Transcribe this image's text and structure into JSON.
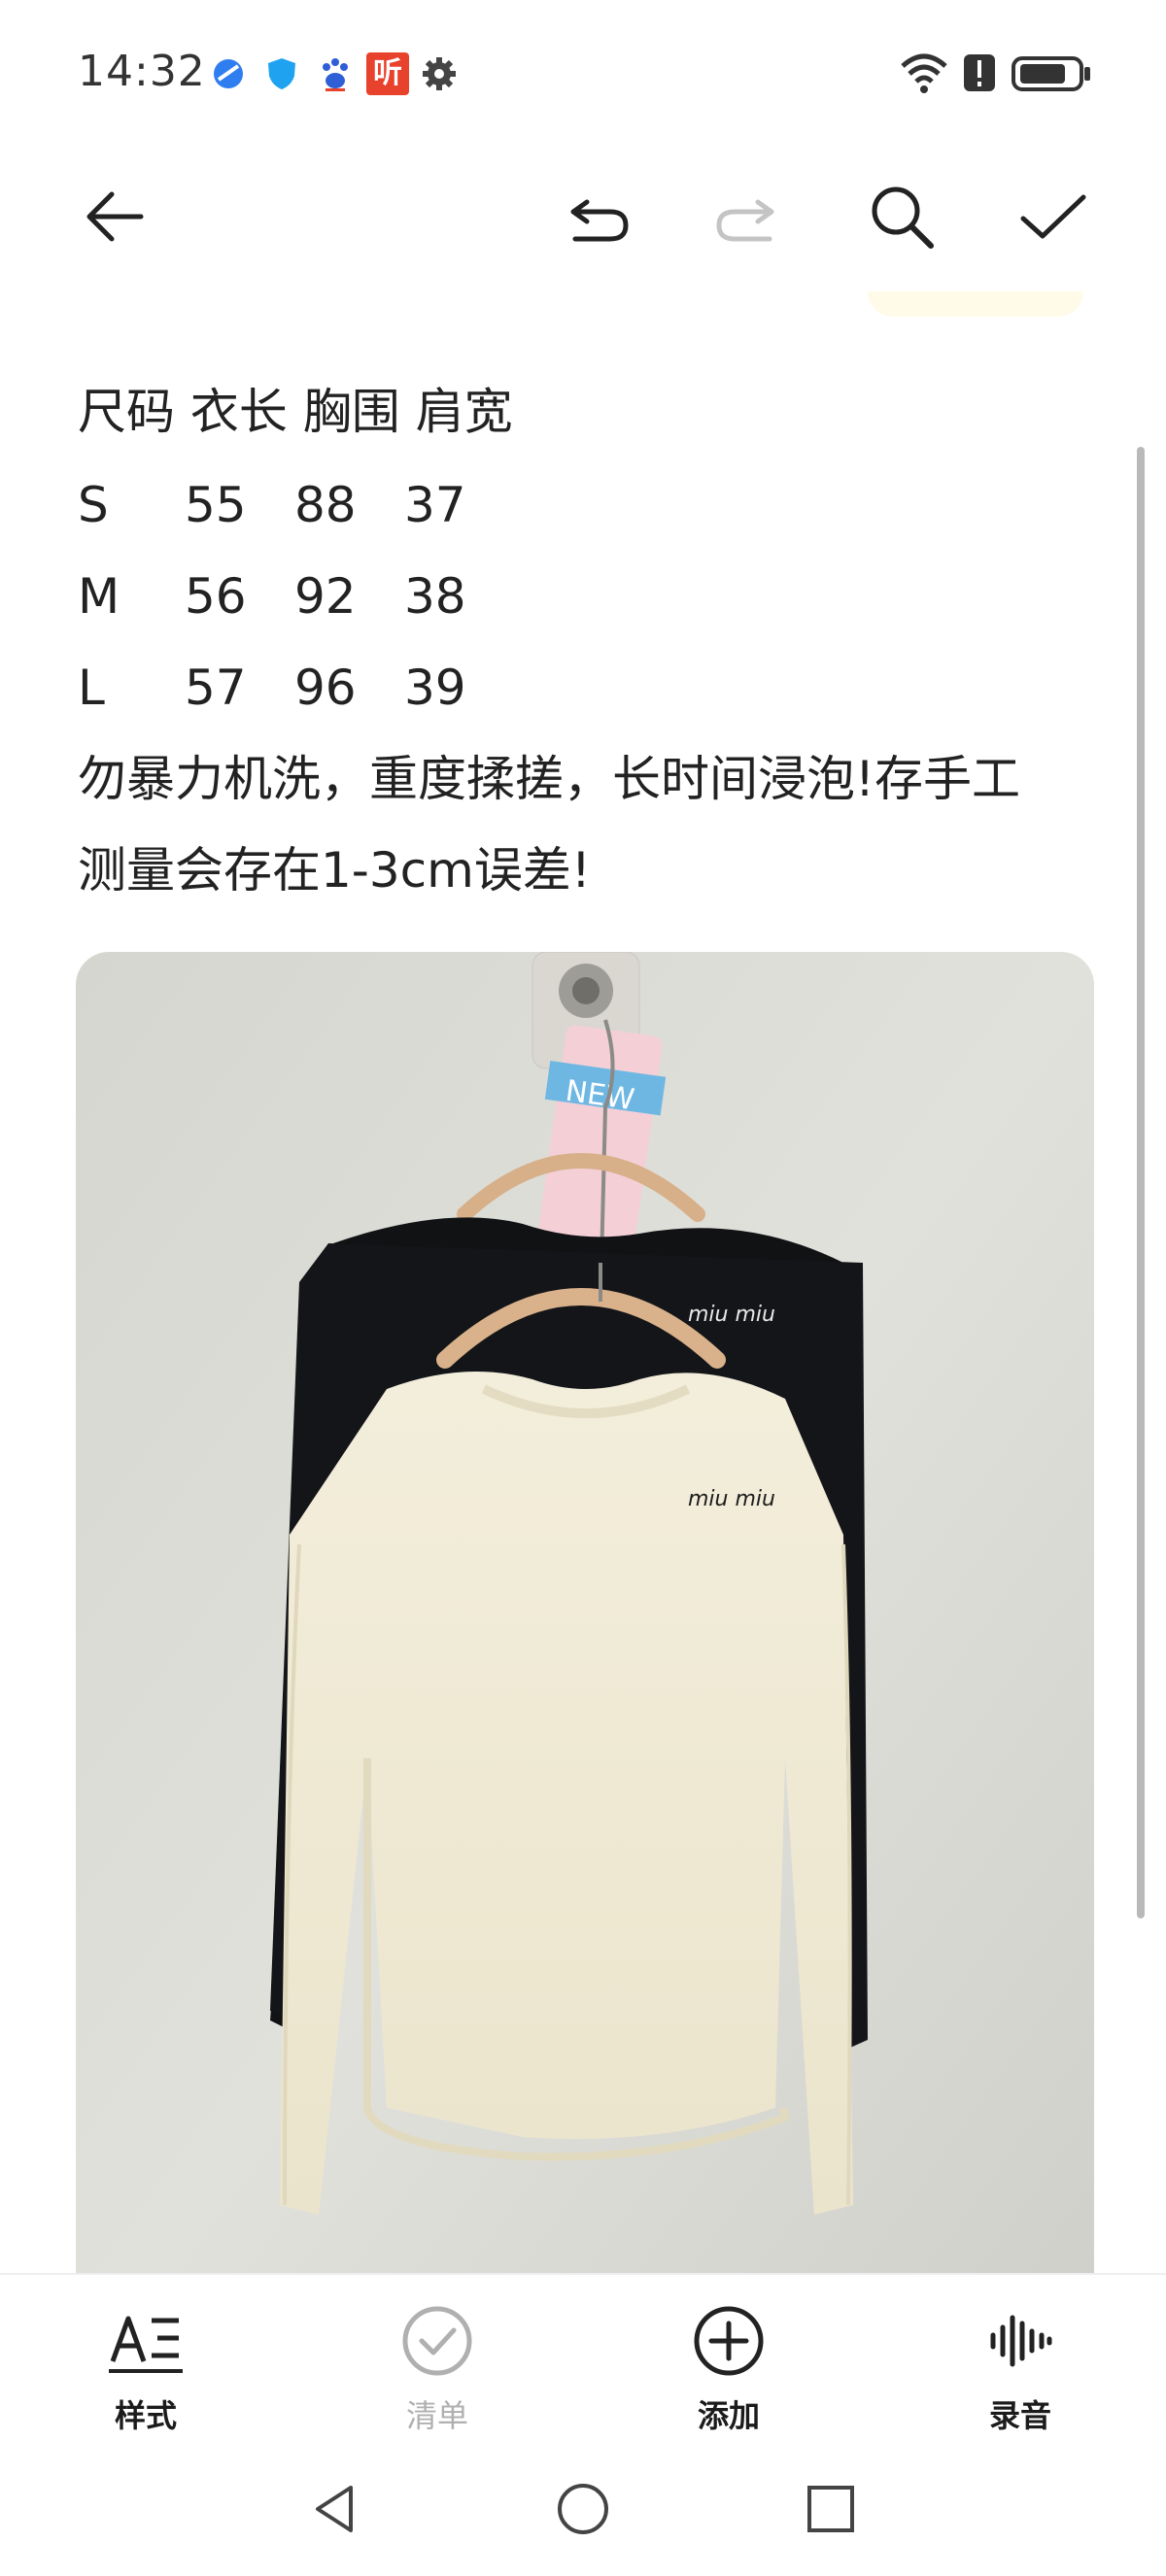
{
  "status_bar": {
    "time": "14:32",
    "left_icons": [
      "browser-icon",
      "shield-icon",
      "baidu-icon",
      "listen-app-icon",
      "settings-icon"
    ],
    "listen_app_char": "听",
    "right_icons": [
      "wifi-icon",
      "alert-icon",
      "battery-icon"
    ]
  },
  "toolbar": {
    "back": "back-arrow-icon",
    "undo": "undo-icon",
    "redo": "redo-icon",
    "search": "search-icon",
    "done": "checkmark-icon"
  },
  "note": {
    "size_header": "尺码 衣长 胸围 肩宽",
    "size_rows": [
      {
        "size": "S",
        "length": "55",
        "chest": "88",
        "shoulder": "37"
      },
      {
        "size": "M",
        "length": "56",
        "chest": "92",
        "shoulder": "38"
      },
      {
        "size": "L",
        "length": "57",
        "chest": "96",
        "shoulder": "39"
      }
    ],
    "care_line1": "勿暴力机洗，重度揉搓，长时间浸泡!存手工",
    "care_line2": "测量会存在1-3cm误差!",
    "photo_logo_text": "miu miu",
    "photo_tag_text": "NEW"
  },
  "bottom_toolbar": {
    "items": [
      {
        "label": "样式",
        "icon": "text-style-icon",
        "enabled": true
      },
      {
        "label": "清单",
        "icon": "checklist-icon",
        "enabled": false
      },
      {
        "label": "添加",
        "icon": "add-circle-icon",
        "enabled": true
      },
      {
        "label": "录音",
        "icon": "voice-record-icon",
        "enabled": true
      }
    ]
  },
  "nav_bar": {
    "back": "nav-back-icon",
    "home": "nav-home-icon",
    "recents": "nav-recents-icon"
  },
  "colors": {
    "text": "#222222",
    "disabled": "#b0b0b0",
    "listen_app_red": "#e8412c",
    "browser_blue": "#2f7ef0",
    "shield_blue": "#1fa3f0"
  }
}
